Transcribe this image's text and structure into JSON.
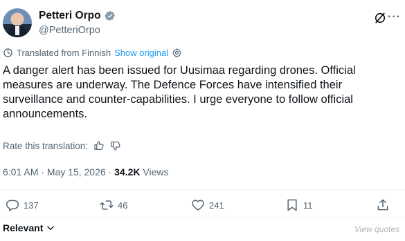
{
  "author": {
    "display_name": "Petteri Orpo",
    "handle": "@PetteriOrpo"
  },
  "translation": {
    "label": "Translated from Finnish",
    "show_original": "Show original"
  },
  "tweet": {
    "text": "A danger alert has been issued for Uusimaa regarding drones. Official measures are underway. The Defence Forces have intensified their surveillance and counter-capabilities. I urge everyone to follow official announcements."
  },
  "rate": {
    "label": "Rate this translation:"
  },
  "meta": {
    "time": "6:01 AM",
    "separator": " · ",
    "date": "May 15, 2026",
    "views_count": "34.2K",
    "views_label": " Views"
  },
  "actions": {
    "replies": "137",
    "reposts": "46",
    "likes": "241",
    "bookmarks": "11"
  },
  "sort": {
    "label": "Relevant"
  },
  "watermark": {
    "text": "View quotes"
  },
  "colors": {
    "accent": "#1d9bf0",
    "text": "#0f1419",
    "secondary": "#536471"
  }
}
